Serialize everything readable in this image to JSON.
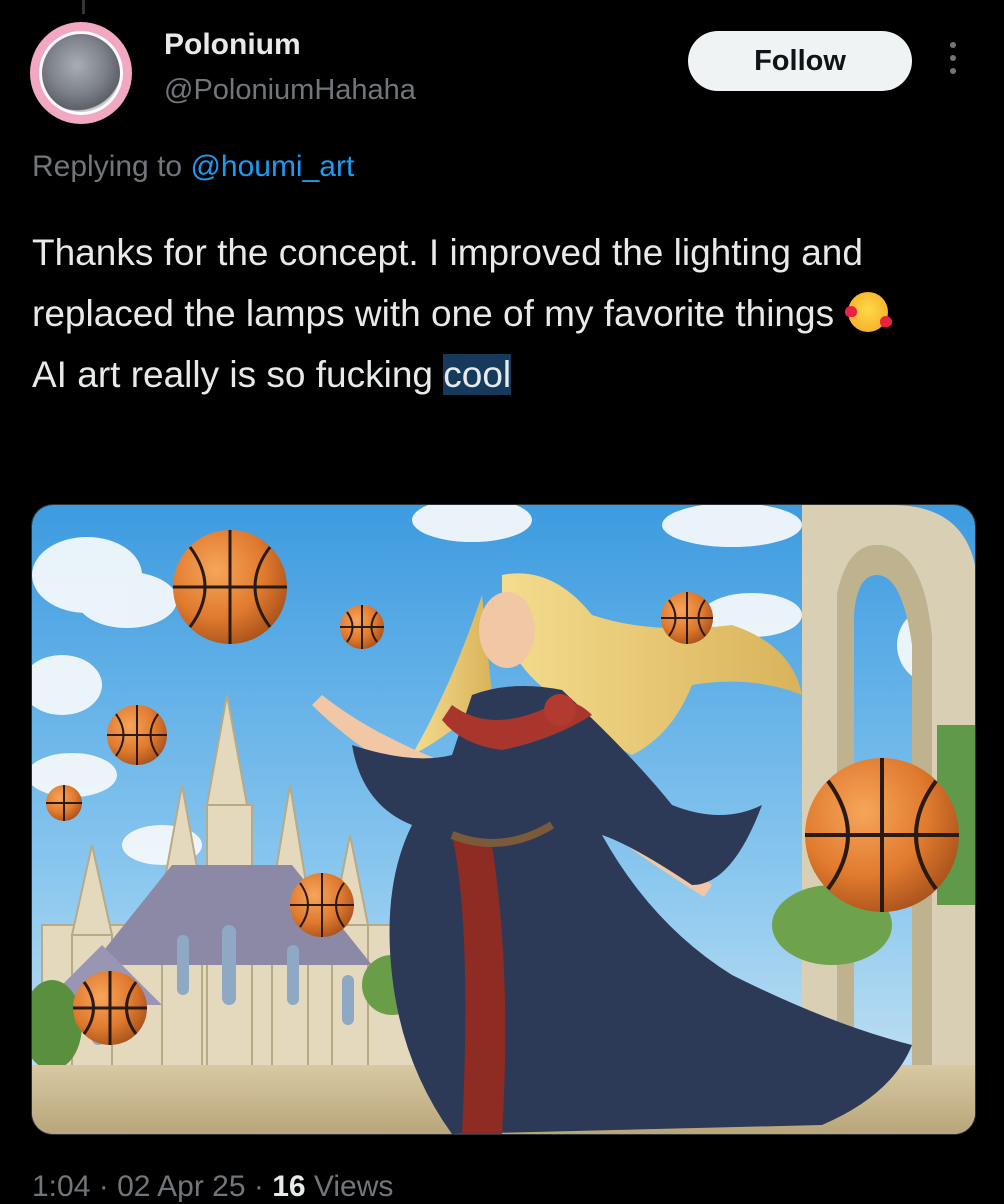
{
  "author": {
    "display_name": "Polonium",
    "handle": "@PoloniumHahaha"
  },
  "follow_label": "Follow",
  "reply": {
    "prefix": "Replying to",
    "mention": "@houmi_art"
  },
  "tweet": {
    "text_part1": "Thanks for the concept. I improved the lighting and replaced the lamps with one of my favorite things",
    "text_part2": "AI art really is so fucking",
    "highlighted_word": "cool",
    "emoji": "smiling-face-with-hearts"
  },
  "meta": {
    "time": "1:04",
    "separator": "·",
    "date": "02 Apr 25",
    "views_count": "16",
    "views_label": "Views"
  },
  "colors": {
    "background": "#000000",
    "link": "#1d9bf0",
    "highlight": "#153a5c",
    "basketball": "#e07a2e"
  }
}
